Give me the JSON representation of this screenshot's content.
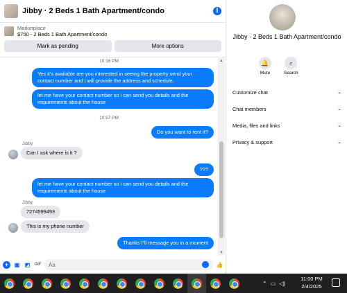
{
  "header": {
    "title": "Jibby · 2 Beds 1 Bath Apartment/condo"
  },
  "marketplace": {
    "label": "Marketplace",
    "listing": "$750 - 2 Beds 1 Bath Apartment/condo",
    "pending_button": "Mark as pending",
    "more_button": "More options"
  },
  "messages": {
    "time1": "10:16 PM",
    "out1": "Yes it's available are you interested in seeing the property send your contact number and I will provide the address and schedule.",
    "out2": "let me have your contact number so i can send you details and the requirements about the house",
    "time2": "10:57 PM",
    "out3": "Do you want to rent it?",
    "sender1": "Jibby",
    "in1": "Can I ask where is it ?",
    "out4": "???",
    "out5": "let me have your contact number so i can send you details and the requirements about the house",
    "sender2": "Jibby",
    "in2": "7274599493",
    "in3": "This is my phone number",
    "out6": "Thanks I\"ll message you in a moment"
  },
  "composer": {
    "placeholder": "Aa"
  },
  "side": {
    "title": "Jibby · 2 Beds 1 Bath Apartment/condo",
    "mute": "Mute",
    "search": "Search",
    "menu": [
      "Customize chat",
      "Chat members",
      "Media, files and links",
      "Privacy & support"
    ]
  },
  "taskbar": {
    "time": "11:00 PM",
    "date": "2/4/2025"
  },
  "colors": {
    "accent": "#0866ff",
    "bubble_out": "#0a7cff",
    "bubble_in": "#e4e6eb"
  }
}
